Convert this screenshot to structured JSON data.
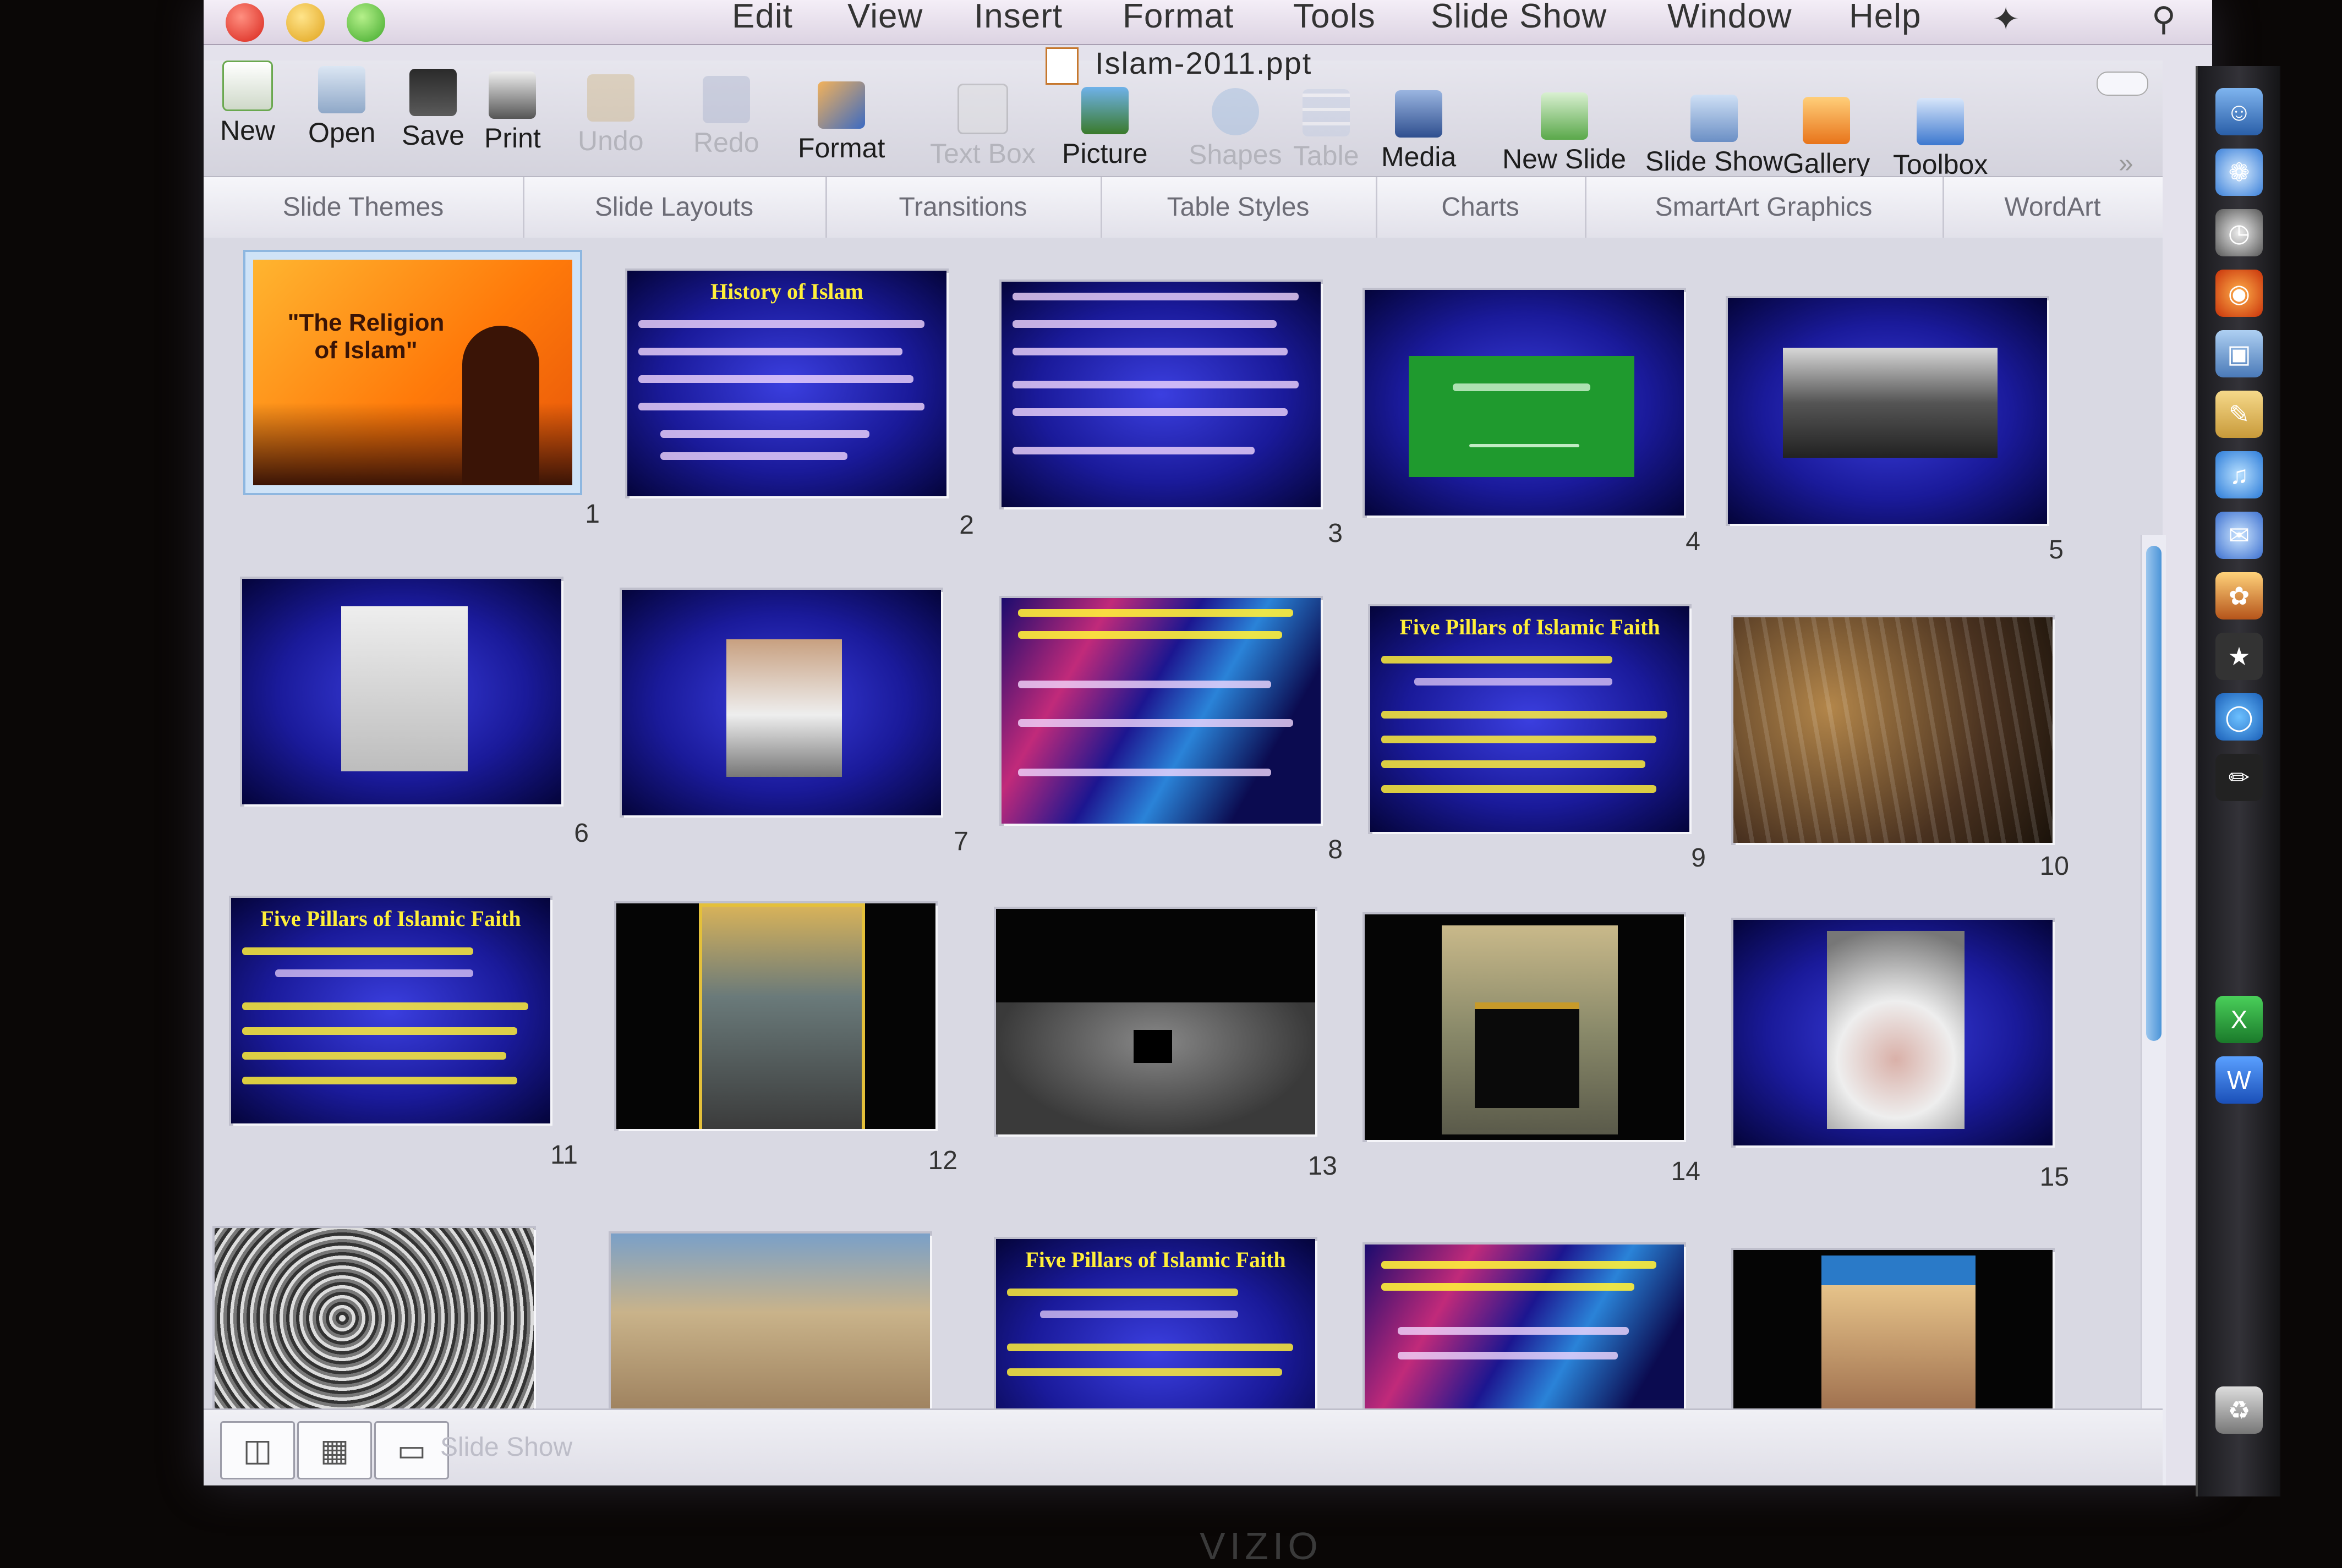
{
  "menubar": {
    "items": [
      "Edit",
      "View",
      "Insert",
      "Format",
      "Tools",
      "Slide Show",
      "Window",
      "Help"
    ]
  },
  "window": {
    "title": "Islam-2011.ppt"
  },
  "toolbar": {
    "buttons": [
      {
        "label": "New",
        "icon": "new-document-icon",
        "enabled": true
      },
      {
        "label": "Open",
        "icon": "open-folder-icon",
        "enabled": true
      },
      {
        "label": "Save",
        "icon": "floppy-disk-icon",
        "enabled": true
      },
      {
        "label": "Print",
        "icon": "printer-icon",
        "enabled": true
      },
      {
        "label": "Undo",
        "icon": "undo-icon",
        "enabled": false
      },
      {
        "label": "Redo",
        "icon": "redo-icon",
        "enabled": false
      },
      {
        "label": "Format",
        "icon": "paintbrush-icon",
        "enabled": true
      },
      {
        "label": "Text Box",
        "icon": "text-box-icon",
        "enabled": false
      },
      {
        "label": "Picture",
        "icon": "picture-icon",
        "enabled": true
      },
      {
        "label": "Shapes",
        "icon": "shapes-icon",
        "enabled": false
      },
      {
        "label": "Table",
        "icon": "table-icon",
        "enabled": false
      },
      {
        "label": "Media",
        "icon": "media-icon",
        "enabled": true
      },
      {
        "label": "New Slide",
        "icon": "new-slide-icon",
        "enabled": true
      },
      {
        "label": "Slide Show",
        "icon": "slideshow-icon",
        "enabled": true
      },
      {
        "label": "Gallery",
        "icon": "gallery-icon",
        "enabled": true
      },
      {
        "label": "Toolbox",
        "icon": "toolbox-icon",
        "enabled": true
      }
    ]
  },
  "ribbon": {
    "tabs": [
      "Slide Themes",
      "Slide Layouts",
      "Transitions",
      "Table Styles",
      "Charts",
      "SmartArt Graphics",
      "WordArt"
    ]
  },
  "slides": [
    {
      "number": "1",
      "title": "\"The Religion of Islam\""
    },
    {
      "number": "2",
      "title": "History of Islam"
    },
    {
      "number": "3",
      "title": ""
    },
    {
      "number": "4",
      "title": ""
    },
    {
      "number": "5",
      "title": ""
    },
    {
      "number": "6",
      "title": ""
    },
    {
      "number": "7",
      "title": ""
    },
    {
      "number": "8",
      "title": ""
    },
    {
      "number": "9",
      "title": "Five Pillars of Islamic Faith"
    },
    {
      "number": "10",
      "title": ""
    },
    {
      "number": "11",
      "title": "Five Pillars of Islamic Faith"
    },
    {
      "number": "12",
      "title": ""
    },
    {
      "number": "13",
      "title": ""
    },
    {
      "number": "14",
      "title": ""
    },
    {
      "number": "15",
      "title": ""
    },
    {
      "number": "",
      "title": ""
    },
    {
      "number": "",
      "title": ""
    },
    {
      "number": "",
      "title": "Five Pillars of Islamic Faith"
    },
    {
      "number": "",
      "title": ""
    },
    {
      "number": "",
      "title": ""
    }
  ],
  "bottombar": {
    "label": "Slide Show"
  },
  "colors": {
    "accent": "#4c95d8",
    "slide_blue": "#1a1a9a",
    "slide_orange": "#ff7a0a",
    "title_yellow": "#ffef3a"
  },
  "dock": {
    "icons": [
      "finder-icon",
      "safari-icon",
      "clock-icon",
      "firefox-icon",
      "preview-icon",
      "notes-icon",
      "itunes-icon",
      "mail-icon",
      "photos-icon",
      "star-icon",
      "chrome-icon",
      "pencil-icon",
      "excel-icon",
      "word-icon",
      "trash-icon"
    ]
  },
  "brand": "VIZIO"
}
